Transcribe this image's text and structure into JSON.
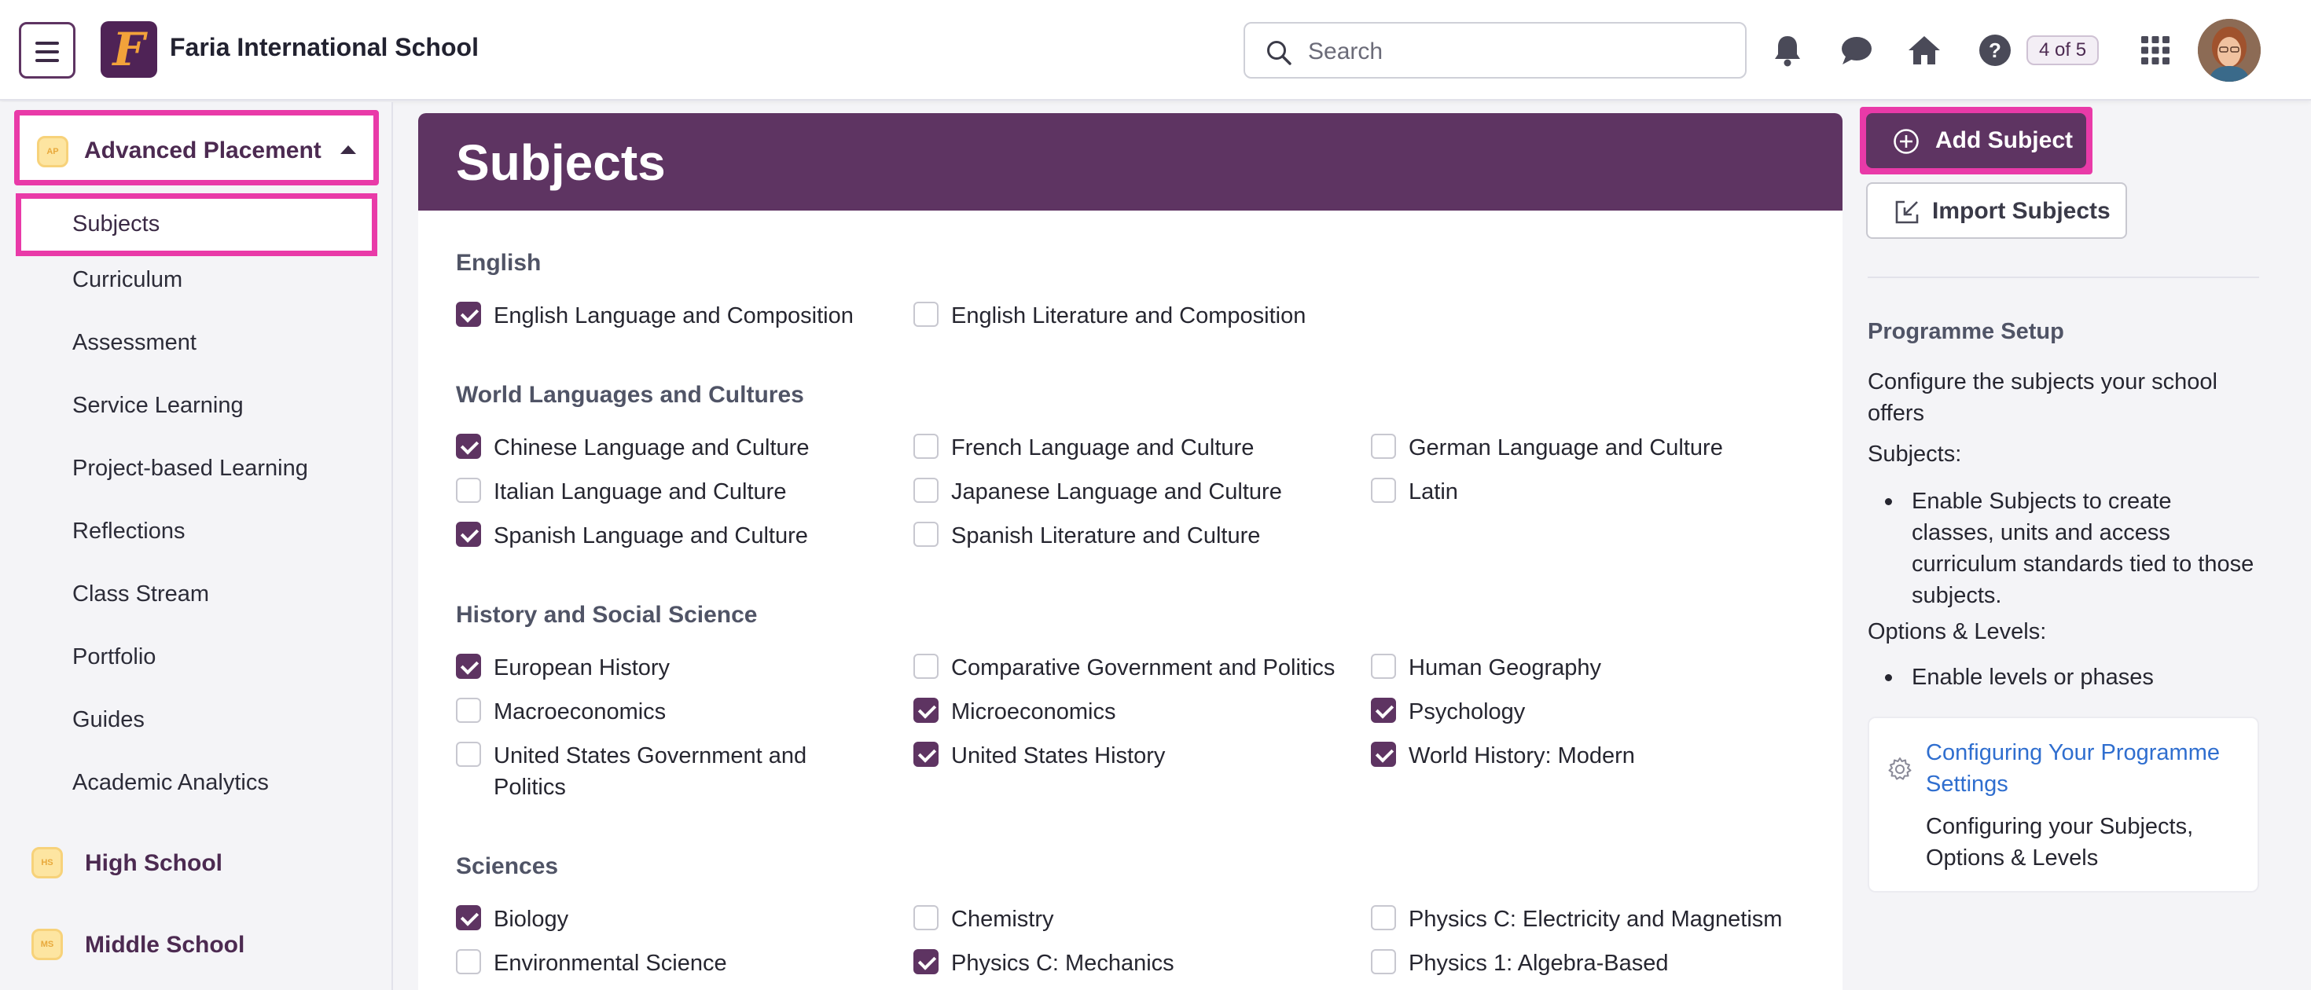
{
  "header": {
    "school_name": "Faria International School",
    "logo_letter": "F",
    "search_placeholder": "Search",
    "badge": "4 of 5",
    "icons": [
      "bell-icon",
      "chat-icon",
      "home-icon",
      "help-icon",
      "apps-grid-icon"
    ]
  },
  "sidebar": {
    "current_programme": {
      "label": "Advanced Placement",
      "badge": "AP"
    },
    "items": [
      {
        "label": "Subjects",
        "active": true
      },
      {
        "label": "Curriculum"
      },
      {
        "label": "Assessment"
      },
      {
        "label": "Service Learning"
      },
      {
        "label": "Project-based Learning"
      },
      {
        "label": "Reflections"
      },
      {
        "label": "Class Stream"
      },
      {
        "label": "Portfolio"
      },
      {
        "label": "Guides"
      },
      {
        "label": "Academic Analytics"
      }
    ],
    "other_programmes": [
      {
        "label": "High School",
        "badge": "HS"
      },
      {
        "label": "Middle School",
        "badge": "MS"
      }
    ]
  },
  "main": {
    "title": "Subjects",
    "categories": [
      {
        "title": "English",
        "subjects": [
          {
            "label": "English Language and Composition",
            "checked": true
          },
          {
            "label": "English Literature and Composition",
            "checked": false
          }
        ]
      },
      {
        "title": "World Languages and Cultures",
        "subjects": [
          {
            "label": "Chinese Language and Culture",
            "checked": true
          },
          {
            "label": "French Language and Culture",
            "checked": false
          },
          {
            "label": "German Language and Culture",
            "checked": false
          },
          {
            "label": "Italian Language and Culture",
            "checked": false
          },
          {
            "label": "Japanese Language and Culture",
            "checked": false
          },
          {
            "label": "Latin",
            "checked": false
          },
          {
            "label": "Spanish Language and Culture",
            "checked": true
          },
          {
            "label": "Spanish Literature and Culture",
            "checked": false
          }
        ]
      },
      {
        "title": "History and Social Science",
        "subjects": [
          {
            "label": "European History",
            "checked": true
          },
          {
            "label": "Comparative Government and Politics",
            "checked": false
          },
          {
            "label": "Human Geography",
            "checked": false
          },
          {
            "label": "Macroeconomics",
            "checked": false
          },
          {
            "label": "Microeconomics",
            "checked": true
          },
          {
            "label": "Psychology",
            "checked": true
          },
          {
            "label": "United States Government and Politics",
            "checked": false
          },
          {
            "label": "United States History",
            "checked": true
          },
          {
            "label": "World History: Modern",
            "checked": true
          }
        ]
      },
      {
        "title": "Sciences",
        "subjects": [
          {
            "label": "Biology",
            "checked": true
          },
          {
            "label": "Chemistry",
            "checked": false
          },
          {
            "label": "Physics C: Electricity and Magnetism",
            "checked": false
          },
          {
            "label": "Environmental Science",
            "checked": false
          },
          {
            "label": "Physics C: Mechanics",
            "checked": true
          },
          {
            "label": "Physics 1: Algebra-Based",
            "checked": false
          }
        ]
      }
    ]
  },
  "right_panel": {
    "add_button": "Add Subject",
    "import_button": "Import Subjects",
    "setup_title": "Programme Setup",
    "setup_desc": "Configure the subjects your school offers",
    "subjects_heading": "Subjects:",
    "subjects_bullet": "Enable Subjects to create classes, units and access curriculum standards tied to those subjects.",
    "options_heading": "Options & Levels:",
    "options_bullet": "Enable levels or phases",
    "help_link": "Configuring Your Programme Settings",
    "help_desc": "Configuring your Subjects, Options & Levels"
  },
  "colors": {
    "brand_purple": "#5e3462",
    "highlight_pink": "#e93aa8",
    "link_blue": "#2f6ecf",
    "logo_orange": "#f2a23a"
  }
}
